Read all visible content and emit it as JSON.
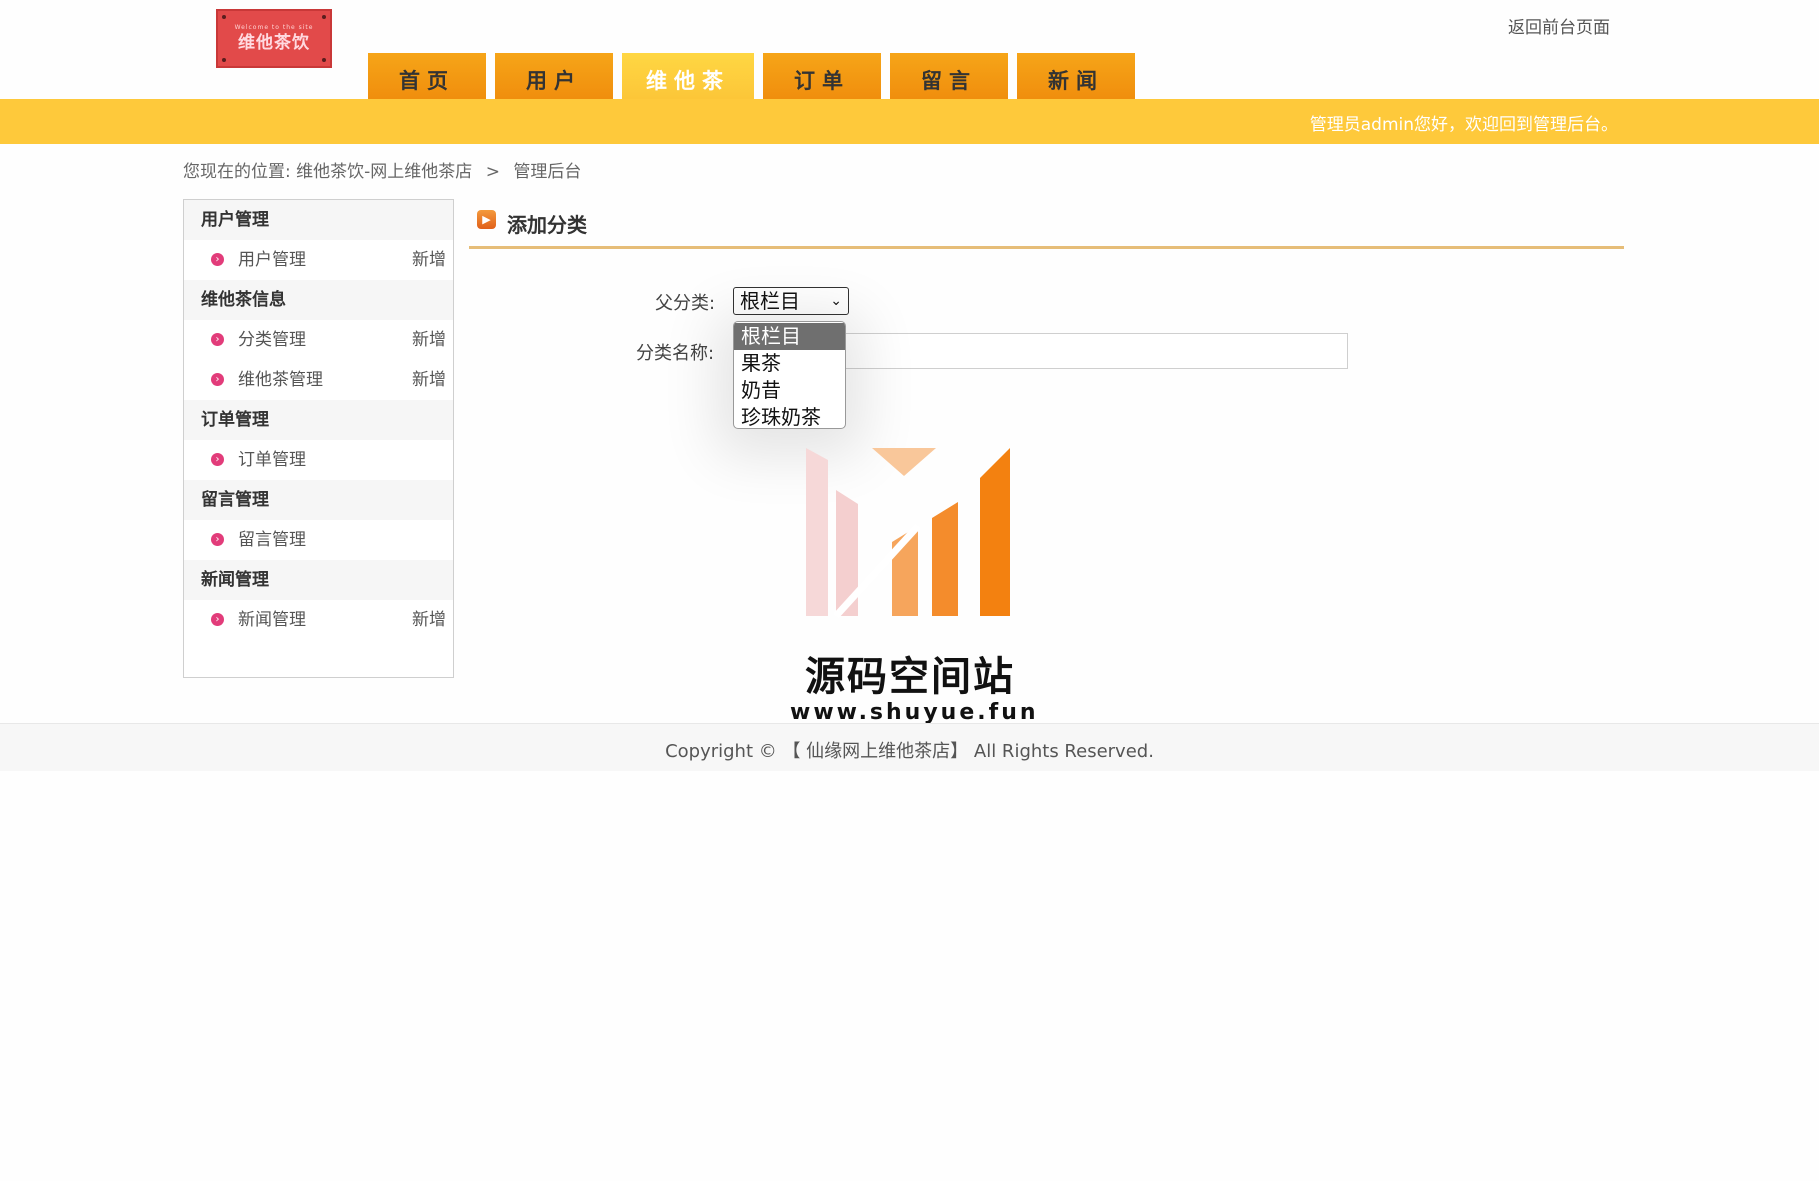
{
  "header": {
    "logo_subtitle": "Welcome to the site",
    "logo_text": "维他茶饮",
    "back_link": "返回前台页面",
    "welcome": "管理员admin您好，欢迎回到管理后台。"
  },
  "nav": {
    "tabs": [
      {
        "label": "首页",
        "active": false
      },
      {
        "label": "用户",
        "active": false
      },
      {
        "label": "维他茶",
        "active": true
      },
      {
        "label": "订单",
        "active": false
      },
      {
        "label": "留言",
        "active": false
      },
      {
        "label": "新闻",
        "active": false
      }
    ]
  },
  "breadcrumb": {
    "prefix": "您现在的位置:",
    "site": "维他茶饮-网上维他茶店",
    "separator": ">",
    "current": "管理后台"
  },
  "sidebar": {
    "sections": [
      {
        "title": "用户管理",
        "items": [
          {
            "label": "用户管理",
            "add": "新增"
          }
        ]
      },
      {
        "title": "维他茶信息",
        "items": [
          {
            "label": "分类管理",
            "add": "新增"
          },
          {
            "label": "维他茶管理",
            "add": "新增"
          }
        ]
      },
      {
        "title": "订单管理",
        "items": [
          {
            "label": "订单管理",
            "add": ""
          }
        ]
      },
      {
        "title": "留言管理",
        "items": [
          {
            "label": "留言管理",
            "add": ""
          }
        ]
      },
      {
        "title": "新闻管理",
        "items": [
          {
            "label": "新闻管理",
            "add": "新增"
          }
        ]
      }
    ]
  },
  "panel": {
    "title": "添加分类"
  },
  "form": {
    "parent_label": "父分类:",
    "parent_selected": "根栏目",
    "name_label": "分类名称:",
    "name_value": "",
    "parent_options": [
      "根栏目",
      "果茶",
      "奶昔",
      "珍珠奶茶"
    ]
  },
  "watermark": {
    "title": "源码空间站",
    "url": "www.shuyue.fun"
  },
  "footer": {
    "copyright": "Copyright © 【 仙缘网上维他茶店】 All Rights Reserved."
  },
  "colors": {
    "nav_tab": "#f4a017",
    "nav_tab_active": "#fec93b",
    "yellow_bar": "#fec93b",
    "bullet": "#e23c7a",
    "title_rule": "#e6bd78",
    "logo_bg": "#e24a4a"
  },
  "icons": {
    "panel_title": "orange-arrow-icon",
    "sidebar_bullet": "pink-chevron-icon",
    "select": "chevron-down-icon"
  }
}
